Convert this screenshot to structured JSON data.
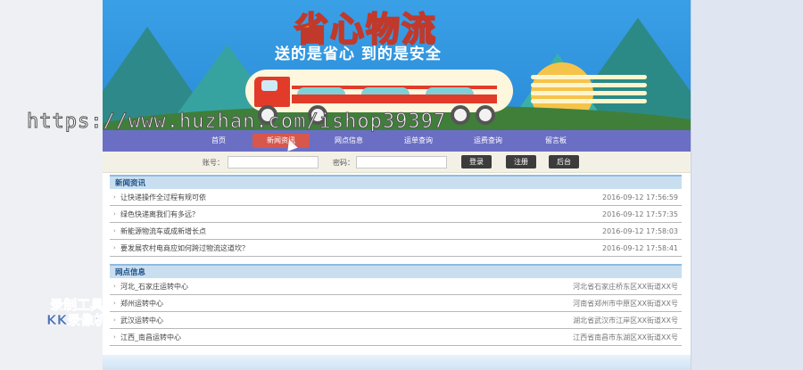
{
  "banner": {
    "title": "省心物流",
    "slogan": "送的是省心 到的是安全"
  },
  "watermark": "https://www.huzhan.com/ishop39397",
  "recorder": {
    "line1": "录制工具",
    "line2": "KK录像机"
  },
  "nav": {
    "items": [
      {
        "label": "首页"
      },
      {
        "label": "新闻资讯"
      },
      {
        "label": "网点信息"
      },
      {
        "label": "运单查询"
      },
      {
        "label": "运费查询"
      },
      {
        "label": "留言板"
      }
    ],
    "active_index": 1
  },
  "login": {
    "account_label": "账号：",
    "password_label": "密码：",
    "login_button": "登录",
    "register_button": "注册",
    "admin_button": "后台"
  },
  "news": {
    "heading": "新闻资讯",
    "items": [
      {
        "title": "让快递操作全过程有规可依",
        "date": "2016-09-12 17:56:59"
      },
      {
        "title": "绿色快递离我们有多远？",
        "date": "2016-09-12 17:57:35"
      },
      {
        "title": "新能源物流车或成新增长点",
        "date": "2016-09-12 17:58:03"
      },
      {
        "title": "要发展农村电商应如何跨过物流这道坎？",
        "date": "2016-09-12 17:58:41"
      }
    ]
  },
  "outlets": {
    "heading": "网点信息",
    "items": [
      {
        "name": "河北_石家庄运转中心",
        "address": "河北省石家庄桥东区XX街道XX号"
      },
      {
        "name": "郑州运转中心",
        "address": "河南省郑州市中原区XX街道XX号"
      },
      {
        "name": "武汉运转中心",
        "address": "湖北省武汉市江岸区XX街道XX号"
      },
      {
        "name": "江西_南昌运转中心",
        "address": "江西省南昌市东湖区XX街道XX号"
      }
    ]
  }
}
